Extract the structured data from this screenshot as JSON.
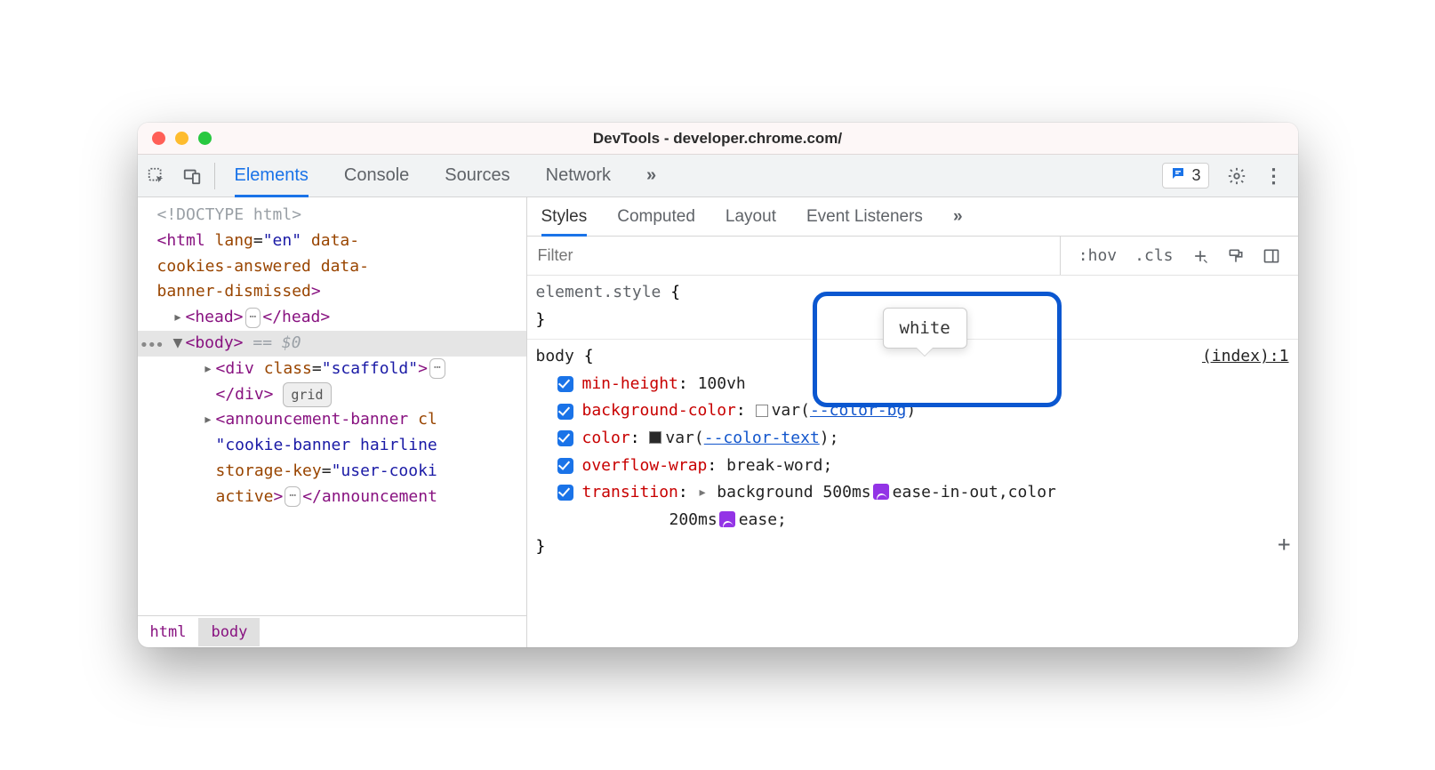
{
  "window": {
    "title": "DevTools - developer.chrome.com/"
  },
  "toptabs": {
    "items": [
      "Elements",
      "Console",
      "Sources",
      "Network"
    ],
    "more_glyph": "»",
    "active_index": 0,
    "issues_count": "3"
  },
  "dom": {
    "doctype": "<!DOCTYPE html>",
    "html_open": {
      "tag": "html",
      "attrs_text": " lang=\"en\" data-cookies-answered data-banner-dismissed"
    },
    "head": {
      "open": "<head>",
      "close": "</head>"
    },
    "body": {
      "open": "<body>",
      "eqvar": " == $0"
    },
    "scaffold": {
      "open": "<div class=\"scaffold\">",
      "close": "</div>",
      "badge": "grid"
    },
    "announcement": {
      "frag": "<announcement-banner cl\n\"cookie-banner hairline\nstorage-key=\"user-cooki\nactive>",
      "close_frag": "</announcement"
    },
    "selected_gutter": "•••"
  },
  "breadcrumb": {
    "items": [
      "html",
      "body"
    ],
    "active_index": 1
  },
  "subtabs": {
    "items": [
      "Styles",
      "Computed",
      "Layout",
      "Event Listeners"
    ],
    "more_glyph": "»",
    "active_index": 0
  },
  "filterbar": {
    "placeholder": "Filter",
    "tools": {
      "hov": ":hov",
      "cls": ".cls"
    }
  },
  "rules": {
    "element_style": {
      "selector": "element.style",
      "open": " {",
      "close": "}"
    },
    "body": {
      "selector": "body",
      "open": " {",
      "close": "}",
      "source": "(index):1",
      "props": [
        {
          "name": "min-height",
          "value": "100vh",
          "value_suffix": ""
        },
        {
          "name": "background-color",
          "value_prefix": "var(",
          "var": "--color-bg",
          "value_suffix": ")",
          "swatch": "white"
        },
        {
          "name": "color",
          "value_prefix": "var(",
          "var": "--color-text",
          "value_suffix": ");",
          "swatch": "black"
        },
        {
          "name": "overflow-wrap",
          "value": "break-word;"
        },
        {
          "name": "transition",
          "parts": {
            "tri": "▸",
            "p1": "background 500ms ",
            "b1": true,
            "p2": "ease-in-out,color",
            "line2_prefix": "200ms ",
            "b2": true,
            "p3": "ease;"
          }
        }
      ]
    }
  },
  "tooltip": {
    "text": "white"
  }
}
